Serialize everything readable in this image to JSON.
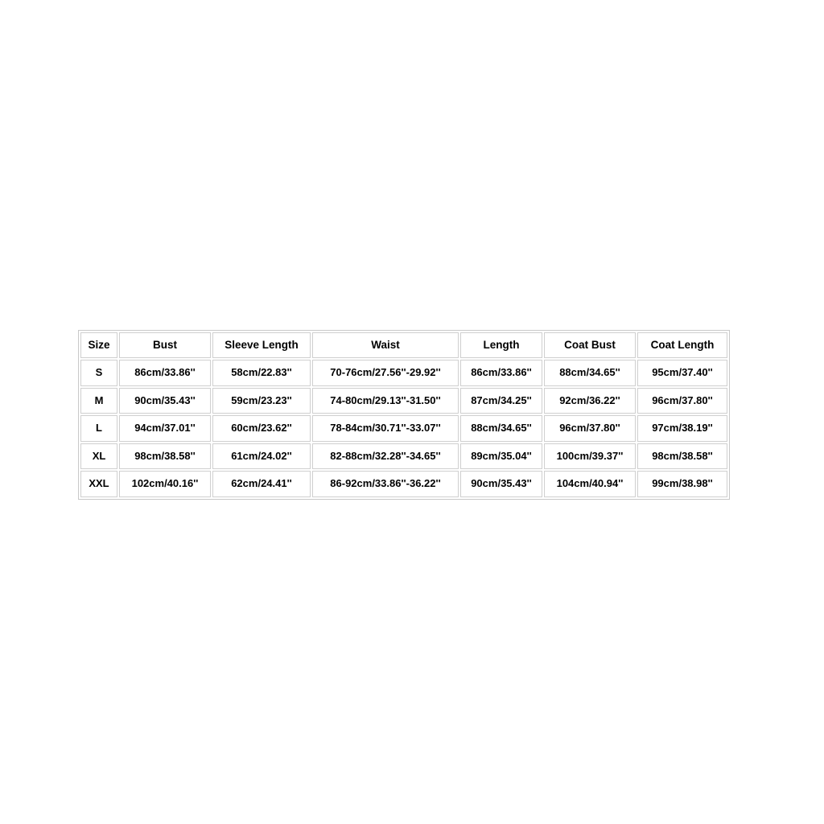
{
  "table": {
    "name": "size-chart",
    "columns": [
      "Size",
      "Bust",
      "Sleeve Length",
      "Waist",
      "Length",
      "Coat Bust",
      "Coat Length"
    ],
    "rows": [
      {
        "size": "S",
        "bust": "86cm/33.86''",
        "sleeve_length": "58cm/22.83''",
        "waist": "70-76cm/27.56''-29.92''",
        "length": "86cm/33.86''",
        "coat_bust": "88cm/34.65''",
        "coat_length": "95cm/37.40''"
      },
      {
        "size": "M",
        "bust": "90cm/35.43''",
        "sleeve_length": "59cm/23.23''",
        "waist": "74-80cm/29.13''-31.50''",
        "length": "87cm/34.25''",
        "coat_bust": "92cm/36.22''",
        "coat_length": "96cm/37.80''"
      },
      {
        "size": "L",
        "bust": "94cm/37.01''",
        "sleeve_length": "60cm/23.62''",
        "waist": "78-84cm/30.71''-33.07''",
        "length": "88cm/34.65''",
        "coat_bust": "96cm/37.80''",
        "coat_length": "97cm/38.19''"
      },
      {
        "size": "XL",
        "bust": "98cm/38.58''",
        "sleeve_length": "61cm/24.02''",
        "waist": "82-88cm/32.28''-34.65''",
        "length": "89cm/35.04''",
        "coat_bust": "100cm/39.37''",
        "coat_length": "98cm/38.58''"
      },
      {
        "size": "XXL",
        "bust": "102cm/40.16''",
        "sleeve_length": "62cm/24.41''",
        "waist": "86-92cm/33.86''-36.22''",
        "length": "90cm/35.43''",
        "coat_bust": "104cm/40.94''",
        "coat_length": "99cm/38.98''"
      }
    ]
  },
  "colors": {
    "background": "#ffffff",
    "text": "#000000",
    "cell_border": "#cfcfcf",
    "table_border": "#c8c8c8"
  }
}
